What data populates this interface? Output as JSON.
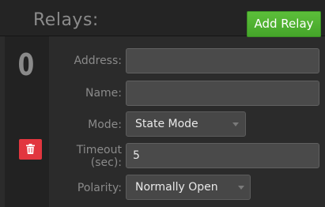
{
  "header": {
    "title": "Relays:",
    "add_button_label": "Add Relay"
  },
  "relay": {
    "index": "0",
    "delete_icon": "trash-icon",
    "fields": {
      "address_label": "Address:",
      "address_value": "",
      "name_label": "Name:",
      "name_value": "",
      "mode_label": "Mode:",
      "mode_value": "State Mode",
      "timeout_label_line1": "Timeout",
      "timeout_label_line2": "(sec):",
      "timeout_value": "5",
      "polarity_label": "Polarity:",
      "polarity_value": "Normally Open"
    }
  },
  "colors": {
    "panel_bg": "#2b2b2b",
    "add_button": "#4fb131",
    "delete_button": "#e2363f",
    "label": "#8a8a8a",
    "input_bg": "#4a4a4a"
  }
}
